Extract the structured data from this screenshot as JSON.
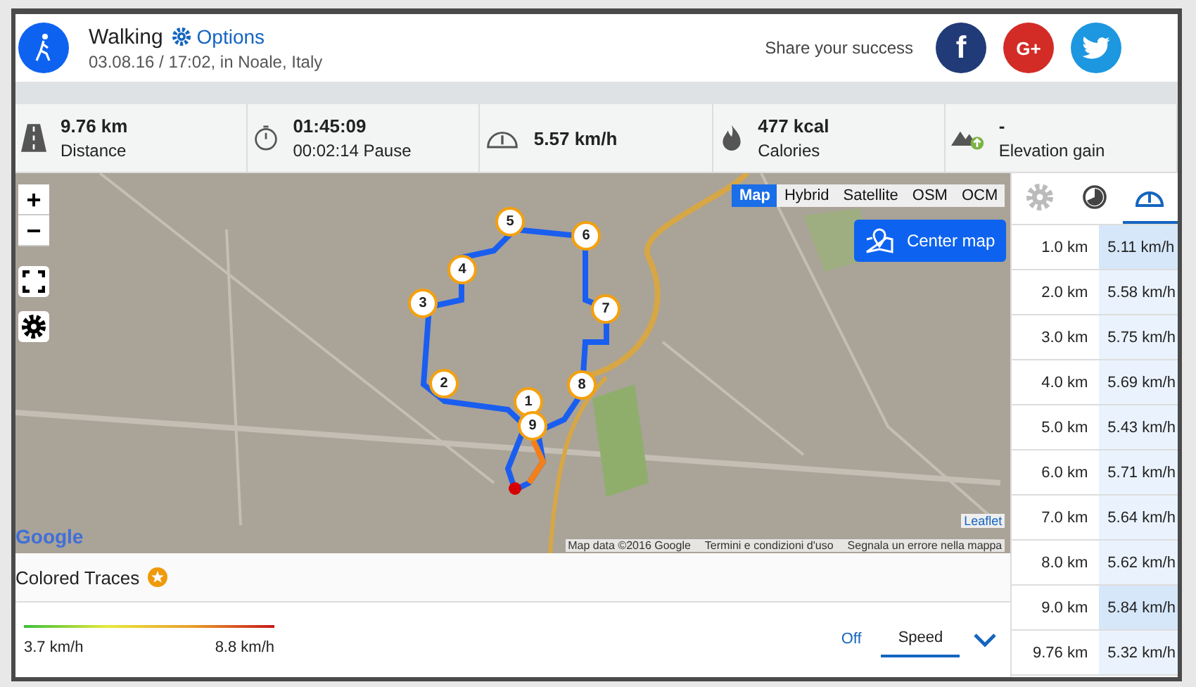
{
  "activity": {
    "title": "Walking",
    "options_label": "Options",
    "subtitle": "03.08.16 / 17:02, in Noale, Italy"
  },
  "share": {
    "label": "Share your success",
    "buttons": [
      {
        "kind": "facebook",
        "label": "f"
      },
      {
        "kind": "google",
        "label": "G+"
      },
      {
        "kind": "twitter"
      }
    ]
  },
  "stats": [
    {
      "kind": "distance",
      "value": "9.76 km",
      "label": "Distance"
    },
    {
      "kind": "time",
      "value": "01:45:09",
      "label": "00:02:14 Pause"
    },
    {
      "kind": "speed",
      "value": "5.57 km/h"
    },
    {
      "kind": "calories",
      "value": "477 kcal",
      "label": "Calories"
    },
    {
      "kind": "elevation",
      "value": "-",
      "label": "Elevation gain"
    }
  ],
  "map": {
    "zoom_in": "+",
    "zoom_out": "−",
    "layers": [
      {
        "label": "Map",
        "selected": true
      },
      {
        "label": "Hybrid",
        "selected": false
      },
      {
        "label": "Satellite",
        "selected": false
      },
      {
        "label": "OSM",
        "selected": false
      },
      {
        "label": "OCM",
        "selected": false
      }
    ],
    "center_button": "Center map",
    "markers": [
      "1",
      "2",
      "3",
      "4",
      "5",
      "6",
      "7",
      "8",
      "9"
    ],
    "google_logo": "Google",
    "attribution": [
      "Map data ©2016 Google",
      "Termini e condizioni d'uso",
      "Segnala un errore nella mappa"
    ],
    "leaflet_link": "Leaflet"
  },
  "splits": {
    "tabs": [
      {
        "kind": "settings",
        "selected": false
      },
      {
        "kind": "pace",
        "selected": false
      },
      {
        "kind": "speed",
        "selected": true
      }
    ],
    "rows": [
      {
        "distance": "1.0 km",
        "speed": "5.11 km/h",
        "selected": true
      },
      {
        "distance": "2.0 km",
        "speed": "5.58 km/h",
        "selected": false
      },
      {
        "distance": "3.0 km",
        "speed": "5.75 km/h",
        "selected": false
      },
      {
        "distance": "4.0 km",
        "speed": "5.69 km/h",
        "selected": false
      },
      {
        "distance": "5.0 km",
        "speed": "5.43 km/h",
        "selected": false
      },
      {
        "distance": "6.0 km",
        "speed": "5.71 km/h",
        "selected": false
      },
      {
        "distance": "7.0 km",
        "speed": "5.64 km/h",
        "selected": false
      },
      {
        "distance": "8.0 km",
        "speed": "5.62 km/h",
        "selected": false
      },
      {
        "distance": "9.0 km",
        "speed": "5.84 km/h",
        "selected": true
      },
      {
        "distance": "9.76 km",
        "speed": "5.32 km/h",
        "selected": false
      }
    ]
  },
  "colored_traces": {
    "title": "Colored Traces",
    "legend_min": "3.7 km/h",
    "legend_max": "8.8 km/h",
    "options": [
      {
        "label": "Off",
        "selected": false
      },
      {
        "label": "Speed",
        "selected": true
      }
    ]
  }
}
